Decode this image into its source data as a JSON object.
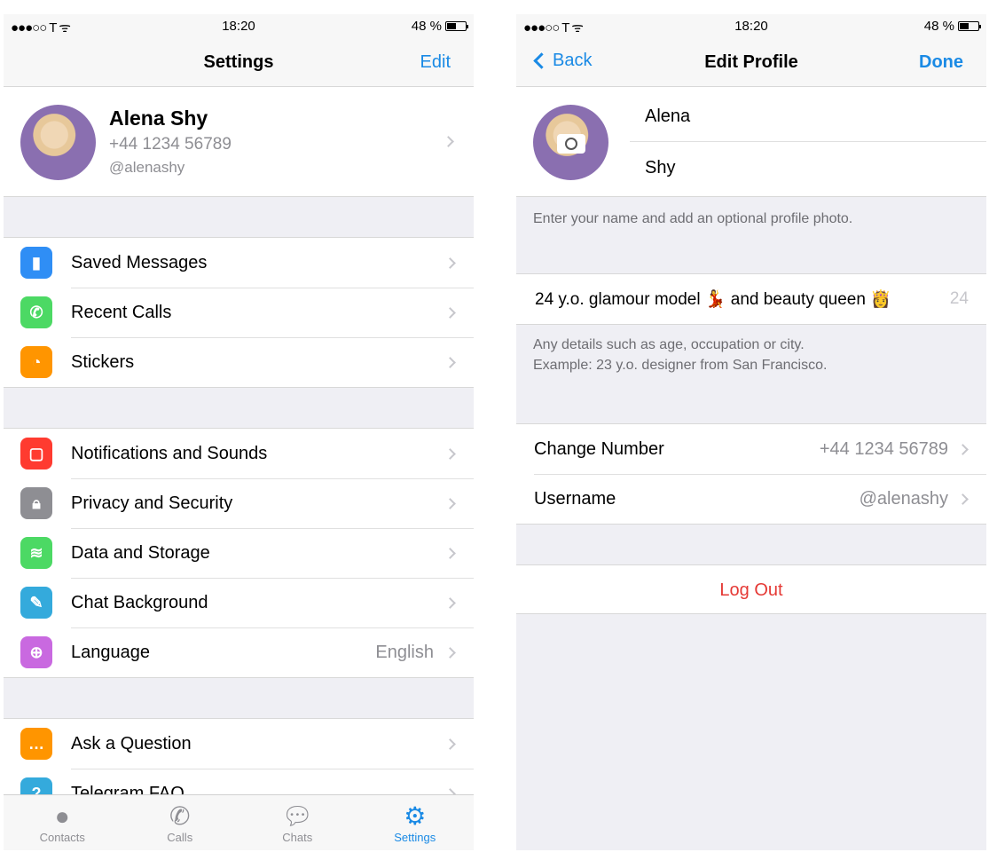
{
  "status": {
    "signal": "●●●○○ T ᯤ",
    "time": "18:20",
    "battery": "48 %",
    "battery_level": 0.48
  },
  "settings": {
    "title": "Settings",
    "edit": "Edit",
    "profile": {
      "name": "Alena Shy",
      "phone": "+44 1234 56789",
      "username": "@alenashy"
    },
    "groups": [
      [
        {
          "label": "Saved Messages",
          "icon": "bookmark-icon",
          "color": "#2f8ef5",
          "glyph": "▮"
        },
        {
          "label": "Recent Calls",
          "icon": "phone-icon",
          "color": "#4cd964",
          "glyph": "✆"
        },
        {
          "label": "Stickers",
          "icon": "sticker-icon",
          "color": "#ff9500",
          "glyph": "◔"
        }
      ],
      [
        {
          "label": "Notifications and Sounds",
          "icon": "notification-icon",
          "color": "#ff3b30",
          "glyph": "▢"
        },
        {
          "label": "Privacy and Security",
          "icon": "lock-icon",
          "color": "#8e8e93",
          "glyph": "🔒︎"
        },
        {
          "label": "Data and Storage",
          "icon": "database-icon",
          "color": "#4cd964",
          "glyph": "≋"
        },
        {
          "label": "Chat Background",
          "icon": "brush-icon",
          "color": "#34aadc",
          "glyph": "✎"
        },
        {
          "label": "Language",
          "icon": "globe-icon",
          "color": "#c969e0",
          "glyph": "⊕",
          "value": "English"
        }
      ],
      [
        {
          "label": "Ask a Question",
          "icon": "chat-bubble-icon",
          "color": "#ff9500",
          "glyph": "…"
        },
        {
          "label": "Telegram FAQ",
          "icon": "question-icon",
          "color": "#34aadc",
          "glyph": "?"
        }
      ]
    ],
    "tabs": [
      {
        "label": "Contacts",
        "icon": "person-icon",
        "glyph": "●"
      },
      {
        "label": "Calls",
        "icon": "phone-icon",
        "glyph": "✆"
      },
      {
        "label": "Chats",
        "icon": "chats-icon",
        "glyph": "💬︎"
      },
      {
        "label": "Settings",
        "icon": "gear-icon",
        "glyph": "⚙",
        "active": true
      }
    ]
  },
  "edit": {
    "back": "Back",
    "title": "Edit Profile",
    "done": "Done",
    "first_name": "Alena",
    "last_name": "Shy",
    "name_hint": "Enter your name and add an optional profile photo.",
    "bio": "24 y.o. glamour model 💃 and beauty queen 👸",
    "bio_remaining": "24",
    "bio_hint_1": "Any details such as age, occupation or city.",
    "bio_hint_2": "Example: 23 y.o. designer from San Francisco.",
    "change_number": "Change Number",
    "phone": "+44 1234 56789",
    "username_label": "Username",
    "username": "@alenashy",
    "logout": "Log Out"
  },
  "colors": {
    "accent": "#1a8ae5",
    "destructive": "#e53935"
  }
}
